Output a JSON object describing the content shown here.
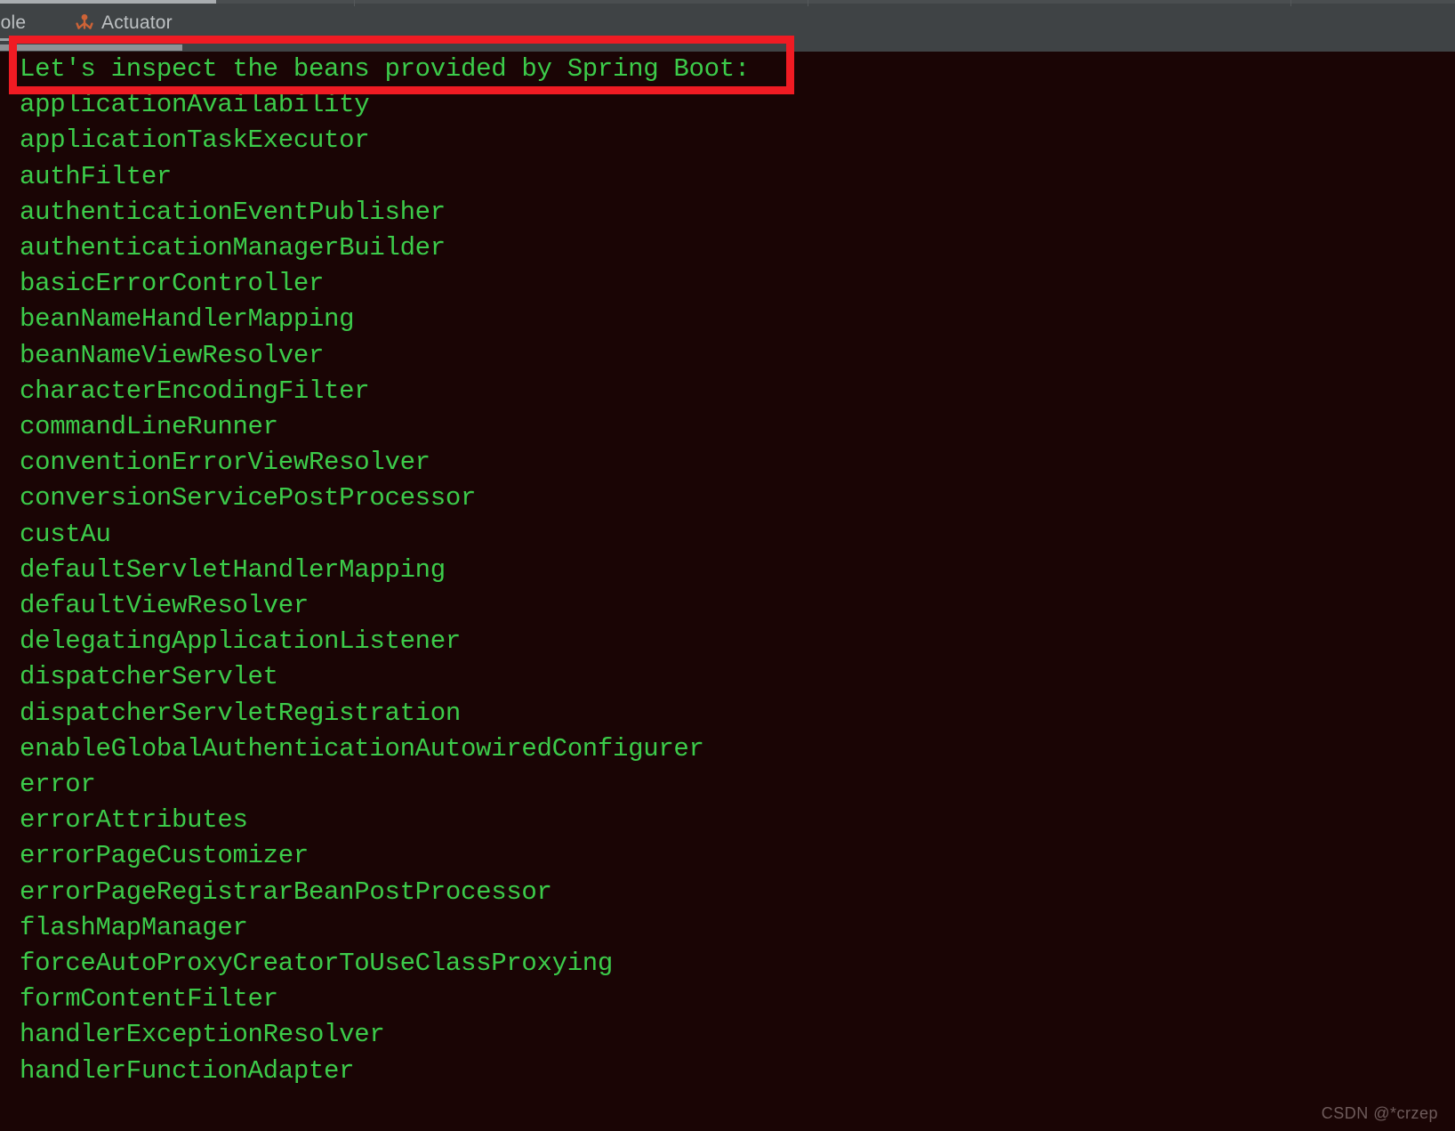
{
  "ide": {
    "tabs": [
      {
        "id": "console",
        "label": "nsole",
        "icon": null,
        "active": true
      },
      {
        "id": "actuator",
        "label": "Actuator",
        "icon": "actuator-figure-icon",
        "active": false
      }
    ]
  },
  "console": {
    "header_line": "Let's inspect the beans provided by Spring Boot:",
    "beans": [
      "applicationAvailability",
      "applicationTaskExecutor",
      "authFilter",
      "authenticationEventPublisher",
      "authenticationManagerBuilder",
      "basicErrorController",
      "beanNameHandlerMapping",
      "beanNameViewResolver",
      "characterEncodingFilter",
      "commandLineRunner",
      "conventionErrorViewResolver",
      "conversionServicePostProcessor",
      "custAu",
      "defaultServletHandlerMapping",
      "defaultViewResolver",
      "delegatingApplicationListener",
      "dispatcherServlet",
      "dispatcherServletRegistration",
      "enableGlobalAuthenticationAutowiredConfigurer",
      "error",
      "errorAttributes",
      "errorPageCustomizer",
      "errorPageRegistrarBeanPostProcessor",
      "flashMapManager",
      "forceAutoProxyCreatorToUseClassProxying",
      "formContentFilter",
      "handlerExceptionResolver",
      "handlerFunctionAdapter"
    ]
  },
  "annotation": {
    "type": "rectangle",
    "target": "header_line",
    "color": "#f01b23"
  },
  "watermark": {
    "text": "CSDN @*crzep"
  },
  "colors": {
    "console_background": "#1a0505",
    "console_text": "#3ccb4a",
    "tabbar_background": "#3f4345",
    "tab_text": "#bdc1c3",
    "annotation_red": "#f01b23",
    "actuator_icon": "#cd6337",
    "watermark_text": "#6e5b5b"
  }
}
